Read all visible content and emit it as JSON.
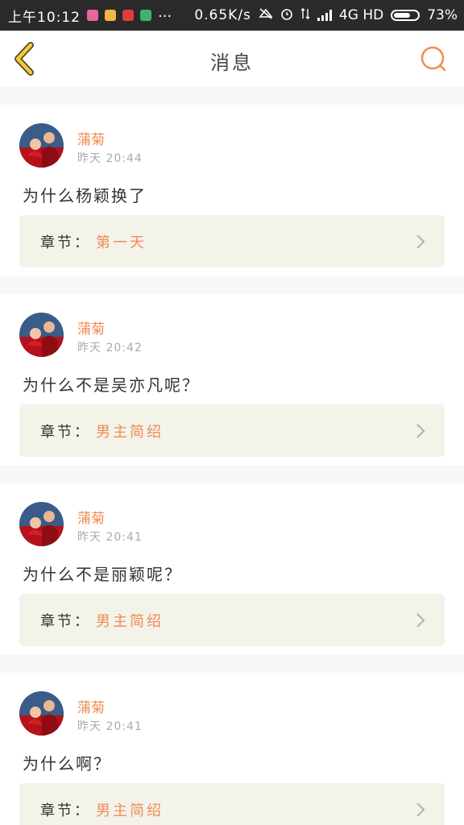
{
  "status_bar": {
    "time": "上午10:12",
    "dots": "...",
    "net_speed": "0.65K/s",
    "network": "4G HD",
    "battery": "73%",
    "battery_level": 0.73
  },
  "header": {
    "title": "消息"
  },
  "messages": [
    {
      "user": "蒲菊",
      "time": "昨天 20:44",
      "text": "为什么杨颖换了",
      "chapter_label": "章节：",
      "chapter": "第一天"
    },
    {
      "user": "蒲菊",
      "time": "昨天 20:42",
      "text": "为什么不是吴亦凡呢？",
      "chapter_label": "章节：",
      "chapter": "男主简绍"
    },
    {
      "user": "蒲菊",
      "time": "昨天 20:41",
      "text": "为什么不是丽颖呢？",
      "chapter_label": "章节：",
      "chapter": "男主简绍"
    },
    {
      "user": "蒲菊",
      "time": "昨天 20:41",
      "text": "为什么啊？",
      "chapter_label": "章节：",
      "chapter": "男主简绍"
    }
  ],
  "colors": {
    "accent": "#f08c52",
    "back_arrow": "#f5c842",
    "card_gap": "#f9f6f6",
    "chapter_bg": "#f3f3ea",
    "status_bar": "#2a2a2a"
  }
}
